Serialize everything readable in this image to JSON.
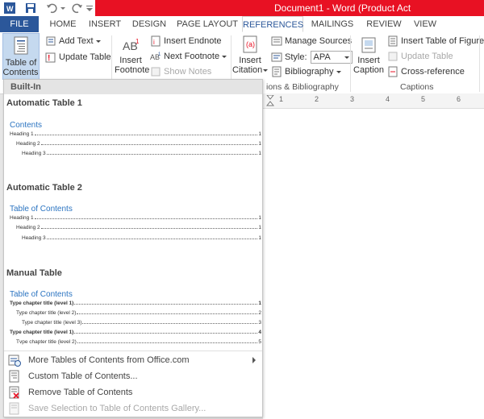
{
  "title_bar": {
    "title": "Document1 - Word (Product Act"
  },
  "ribbon_tabs": [
    {
      "label": "FILE"
    },
    {
      "label": "HOME"
    },
    {
      "label": "INSERT"
    },
    {
      "label": "DESIGN"
    },
    {
      "label": "PAGE LAYOUT"
    },
    {
      "label": "REFERENCES"
    },
    {
      "label": "MAILINGS"
    },
    {
      "label": "REVIEW"
    },
    {
      "label": "VIEW"
    }
  ],
  "ribbon": {
    "toc_button": {
      "line1": "Table of",
      "line2": "Contents"
    },
    "add_text": "Add Text",
    "update_table": "Update Table",
    "insert_footnote": {
      "line1": "Insert",
      "line2": "Footnote"
    },
    "insert_endnote": "Insert Endnote",
    "next_footnote": "Next Footnote",
    "show_notes": "Show Notes",
    "insert_citation": {
      "line1": "Insert",
      "line2": "Citation"
    },
    "manage_sources": "Manage Sources",
    "style_label": "Style:",
    "style_value": "APA",
    "bibliography": "Bibliography",
    "citations_group_label": "ions & Bibliography",
    "insert_caption": {
      "line1": "Insert",
      "line2": "Caption"
    },
    "insert_table_of_figures": "Insert Table of Figures",
    "update_table_captions": "Update Table",
    "cross_reference": "Cross-reference",
    "captions_group_label": "Captions"
  },
  "ruler": {
    "marks": [
      "1",
      "2",
      "3",
      "4",
      "5",
      "6"
    ]
  },
  "dropdown": {
    "header": "Built-In",
    "galleries": [
      {
        "title": "Automatic Table 1",
        "toc_heading": "Contents",
        "entries": [
          {
            "text": "Heading 1",
            "page": "1",
            "bold": false
          },
          {
            "text": "Heading 2",
            "page": "1",
            "bold": false
          },
          {
            "text": "Heading 3",
            "page": "1",
            "bold": false
          }
        ]
      },
      {
        "title": "Automatic Table 2",
        "toc_heading": "Table of Contents",
        "entries": [
          {
            "text": "Heading 1",
            "page": "1",
            "bold": false
          },
          {
            "text": "Heading 2",
            "page": "1",
            "bold": false
          },
          {
            "text": "Heading 3",
            "page": "1",
            "bold": false
          }
        ]
      },
      {
        "title": "Manual Table",
        "toc_heading": "Table of Contents",
        "entries": [
          {
            "text": "Type chapter title (level 1)",
            "page": "1",
            "bold": true
          },
          {
            "text": "Type chapter title (level 2)",
            "page": "2",
            "bold": false
          },
          {
            "text": "Type chapter title (level 3)",
            "page": "3",
            "bold": false
          },
          {
            "text": "Type chapter title (level 1)",
            "page": "4",
            "bold": true
          },
          {
            "text": "Tvpe chapter title (level 2)",
            "page": "5",
            "bold": false
          }
        ]
      }
    ],
    "menu_items": [
      {
        "label": "More Tables of Contents from Office.com",
        "icon": "office-web-icon",
        "disabled": false
      },
      {
        "label": "Custom Table of Contents...",
        "icon": "custom-toc-icon",
        "disabled": false
      },
      {
        "label": "Remove Table of Contents",
        "icon": "remove-toc-icon",
        "disabled": false
      },
      {
        "label": "Save Selection to Table of Contents Gallery...",
        "icon": "save-selection-icon",
        "disabled": true
      }
    ]
  },
  "colors": {
    "accent_blue": "#2b579a",
    "title_red": "#e81123",
    "toc_heading_blue": "#2b74c1",
    "pressed_button": "#c5d9ef"
  }
}
